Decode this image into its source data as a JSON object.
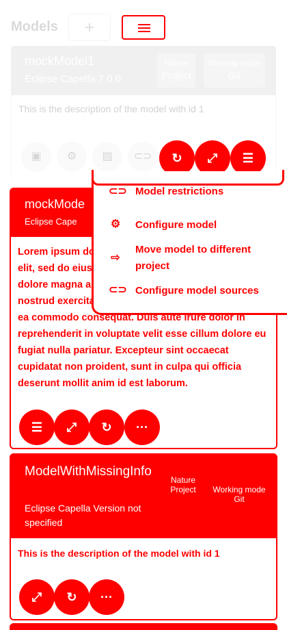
{
  "header": {
    "title": "Models",
    "add_label": "+"
  },
  "card1": {
    "name": "mockModel1",
    "version": "Eclipse Capella 7.0.0",
    "chip_project_label": "Nature",
    "chip_project_value": "Project",
    "chip_mode_label": "Working mode",
    "chip_mode_value": "Git",
    "description": "This is the description of the model with id 1"
  },
  "dropdown": {
    "items": [
      {
        "label": "Model restrictions",
        "icon": "link-icon"
      },
      {
        "label": "Configure model",
        "icon": "gear-icon"
      },
      {
        "label": "Move model to different project",
        "icon": "move-folder-icon"
      },
      {
        "label": "Configure model sources",
        "icon": "link-icon"
      }
    ]
  },
  "card2": {
    "name": "mockMode",
    "version": "Eclipse Cape",
    "description": "Lorem ipsum dolor sit amet, consectetur adipiscing elit, sed do eiusmod tempor incididunt ut labore et dolore magna aliqua. Ut enim ad minim veniam, quis nostrud exercitation ullamco laboris nisi ut aliquip ex ea commodo consequat. Duis aute irure dolor in reprehenderit in voluptate velit esse cillum dolore eu fugiat nulla pariatur. Excepteur sint occaecat cupidatat non proident, sunt in culpa qui officia deserunt mollit anim id est laborum.",
    "more_label": "···"
  },
  "card3": {
    "name": "ModelWithMissingInfo",
    "version": "Eclipse Capella Version not specified",
    "chip_nature": "Nature",
    "chip_project": "Project",
    "chip_mode": "Working mode",
    "chip_git": "Git",
    "description": "This is the description of the model with id 1",
    "more_label": "···"
  },
  "colors": {
    "accent": "#ff0000",
    "faded_header": "#bdbdbd"
  }
}
